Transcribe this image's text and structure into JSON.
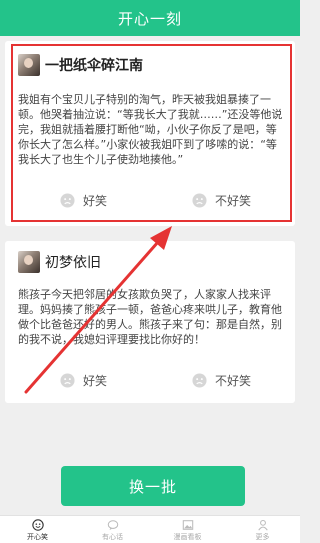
{
  "header": {
    "title": "开心一刻"
  },
  "jokes": [
    {
      "user": "一把纸伞碎江南",
      "text": "我姐有个宝贝儿子特别的淘气，昨天被我姐暴揍了一顿。他哭着抽泣说：“等我长大了我就……”还没等他说完，我姐就插着腰打断他“呦，小伙子你反了是吧，等你长大了怎么样。”小家伙被我姐吓到了哆嗦的说：“等我长大了也生个儿子使劲地揍他。”",
      "like_label": "好笑",
      "dislike_label": "不好笑"
    },
    {
      "user": "初梦依旧",
      "text": "熊孩子今天把邻居的女孩欺负哭了，人家家人找来评理。妈妈揍了熊孩子一顿，爸爸心疼来哄儿子，教育他做个比爸爸还好的男人。熊孩子来了句：那是自然，别的我不说，我媳妇评理要找比你好的！",
      "like_label": "好笑",
      "dislike_label": "不好笑"
    }
  ],
  "refresh_button": "换一批",
  "tabs": [
    {
      "label": "开心笑",
      "icon": "smile-icon",
      "active": true
    },
    {
      "label": "有心话",
      "icon": "chat-icon",
      "active": false
    },
    {
      "label": "漫画看板",
      "icon": "image-icon",
      "active": false
    },
    {
      "label": "更多",
      "icon": "user-icon",
      "active": false
    }
  ],
  "colors": {
    "accent": "#23c38a",
    "highlight": "#e53333"
  }
}
